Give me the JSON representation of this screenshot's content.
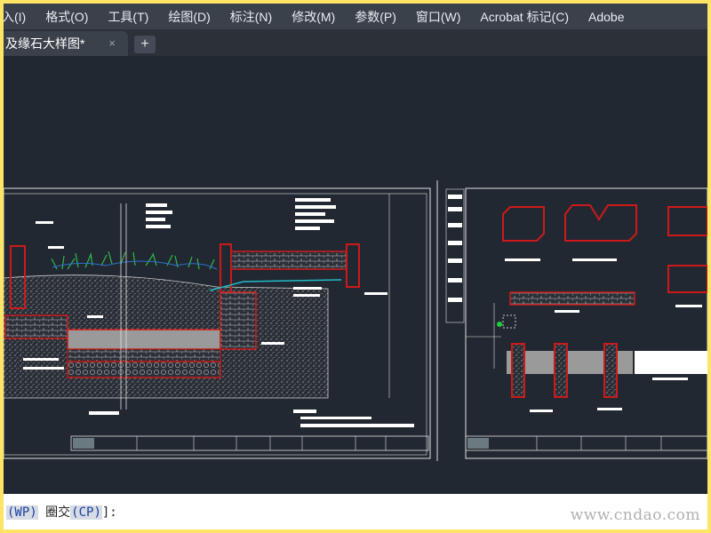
{
  "menu": [
    "入(I)",
    "格式(O)",
    "工具(T)",
    "绘图(D)",
    "标注(N)",
    "修改(M)",
    "参数(P)",
    "窗口(W)",
    "Acrobat 标记(C)",
    "Adobe"
  ],
  "tab": {
    "title": "及缘石大样图*",
    "close": "×",
    "new": "+"
  },
  "command": {
    "wp": "(WP)",
    "cp_prefix": "圈交",
    "cp": "(CP)",
    "suffix": "]:"
  },
  "watermark": "www.cndao.com",
  "colors": {
    "background": "#222831",
    "border": "#ffe566",
    "line": "#cc1a1a",
    "vegetation": "#2fb84a",
    "cyan": "#1fbcc7"
  }
}
